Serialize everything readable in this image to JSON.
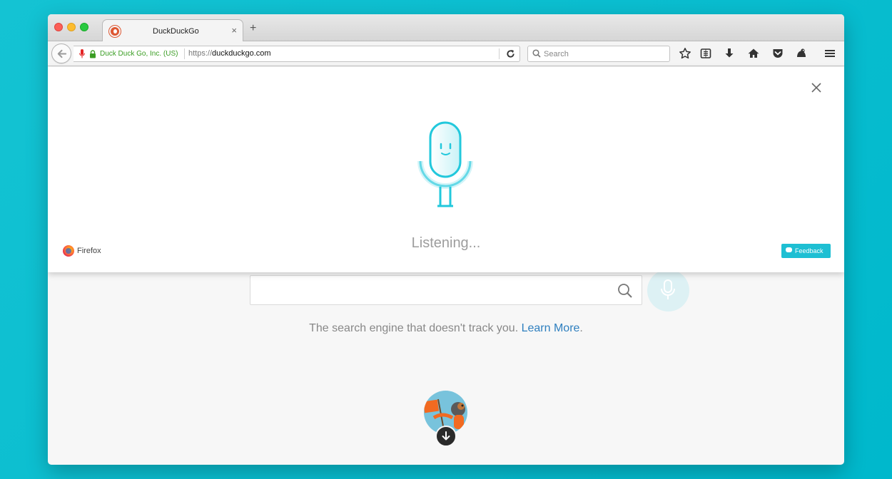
{
  "browser": {
    "tab": {
      "title": "DuckDuckGo",
      "close": "×"
    },
    "new_tab": "+",
    "urlbar": {
      "identity": "Duck Duck Go, Inc. (US)",
      "url_prefix": "https://",
      "url_host": "duckduckgo.com"
    },
    "searchbar": {
      "placeholder": "Search"
    },
    "toolbar_icons": [
      "star-icon",
      "reading-list-icon",
      "download-icon",
      "home-icon",
      "pocket-icon",
      "extension-icon",
      "menu-icon"
    ]
  },
  "voice_overlay": {
    "status": "Listening...",
    "brand": "Firefox",
    "feedback_label": "Feedback",
    "accent_color": "#1ebfd3"
  },
  "page": {
    "tagline": "The search engine that doesn't track you.",
    "learn_more": "Learn More",
    "tagline_end": ".",
    "link_color": "#2e7fbf"
  }
}
